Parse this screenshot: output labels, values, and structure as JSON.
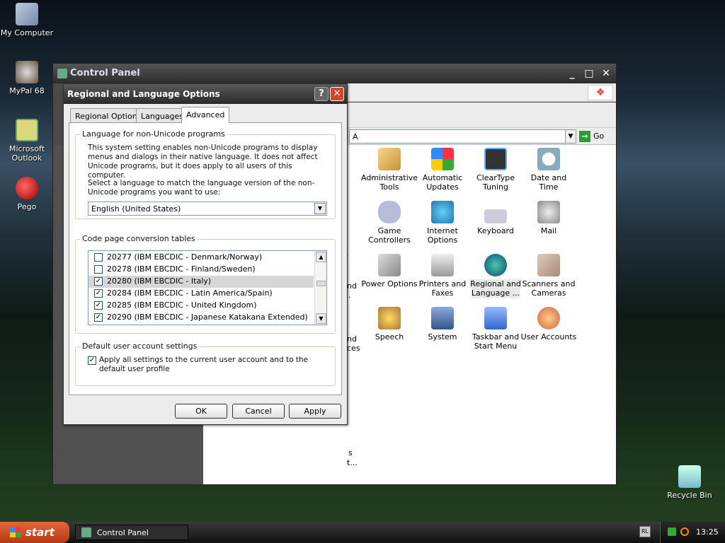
{
  "desktop": {
    "icons": [
      {
        "label": "My Computer",
        "icon": "my-computer-icon"
      },
      {
        "label": "MyPal 68",
        "icon": "mypal-browser-icon"
      },
      {
        "label": "Microsoft Outlook",
        "icon": "outlook-icon"
      },
      {
        "label": "Pego",
        "icon": "pego-icon"
      },
      {
        "label": "Recycle Bin",
        "icon": "recycle-bin-icon"
      }
    ]
  },
  "control_panel": {
    "title": "Control Panel",
    "address_prefix": "A",
    "go_label": "Go",
    "items": [
      {
        "label": "Administrative Tools",
        "icon": "administrative-tools-icon"
      },
      {
        "label": "Automatic Updates",
        "icon": "automatic-updates-icon"
      },
      {
        "label": "ClearType Tuning",
        "icon": "cleartype-icon"
      },
      {
        "label": "Date and Time",
        "icon": "date-time-icon"
      },
      {
        "label": "Game Controllers",
        "icon": "game-controllers-icon"
      },
      {
        "label": "Internet Options",
        "icon": "internet-options-icon"
      },
      {
        "label": "Keyboard",
        "icon": "keyboard-icon"
      },
      {
        "label": "Mail",
        "icon": "mail-icon"
      },
      {
        "label": "Power Options",
        "icon": "power-options-icon"
      },
      {
        "label": "Printers and Faxes",
        "icon": "printers-icon"
      },
      {
        "label": "Regional and Language ...",
        "icon": "regional-language-icon"
      },
      {
        "label": "Scanners and Cameras",
        "icon": "scanners-icon"
      },
      {
        "label": "Speech",
        "icon": "speech-icon"
      },
      {
        "label": "System",
        "icon": "system-icon"
      },
      {
        "label": "Taskbar and Start Menu",
        "icon": "taskbar-start-icon"
      },
      {
        "label": "User Accounts",
        "icon": "user-accounts-icon"
      }
    ],
    "partial_labels": [
      ".",
      "nd",
      ".",
      "nd",
      "ces",
      "s",
      "t..."
    ]
  },
  "dialog": {
    "title": "Regional and Language Options",
    "help_glyph": "?",
    "close_glyph": "✕",
    "tabs": [
      "Regional Options",
      "Languages",
      "Advanced"
    ],
    "active_tab": "Advanced",
    "non_unicode": {
      "heading": "Language for non-Unicode programs",
      "description": "This system setting enables non-Unicode programs to display menus and dialogs in their native language. It does not affect Unicode programs, but it does apply to all users of this computer.",
      "instruction": "Select a language to match the language version of the non-Unicode programs you want to use:",
      "selected_language": "English (United States)"
    },
    "code_pages": {
      "heading": "Code page conversion tables",
      "rows": [
        {
          "label": "20277 (IBM EBCDIC - Denmark/Norway)",
          "checked": false
        },
        {
          "label": "20278 (IBM EBCDIC - Finland/Sweden)",
          "checked": false
        },
        {
          "label": "20280 (IBM EBCDIC - Italy)",
          "checked": true,
          "selected": true
        },
        {
          "label": "20284 (IBM EBCDIC - Latin America/Spain)",
          "checked": true
        },
        {
          "label": "20285 (IBM EBCDIC - United Kingdom)",
          "checked": true
        },
        {
          "label": "20290 (IBM EBCDIC - Japanese Katakana Extended)",
          "checked": true
        }
      ]
    },
    "default_user": {
      "heading": "Default user account settings",
      "checkbox_label": "Apply all settings to the current user account and to the default user profile",
      "checked": true
    },
    "buttons": {
      "ok": "OK",
      "cancel": "Cancel",
      "apply": "Apply"
    }
  },
  "taskbar": {
    "start_label": "start",
    "task_label": "Control Panel",
    "language_indicator": "RL",
    "clock": "13:25"
  },
  "colors": {
    "title_bar": "#2c2c2c",
    "close_button": "#d24726",
    "start_button": "#d0502a",
    "selection": "#d6d6d6"
  }
}
